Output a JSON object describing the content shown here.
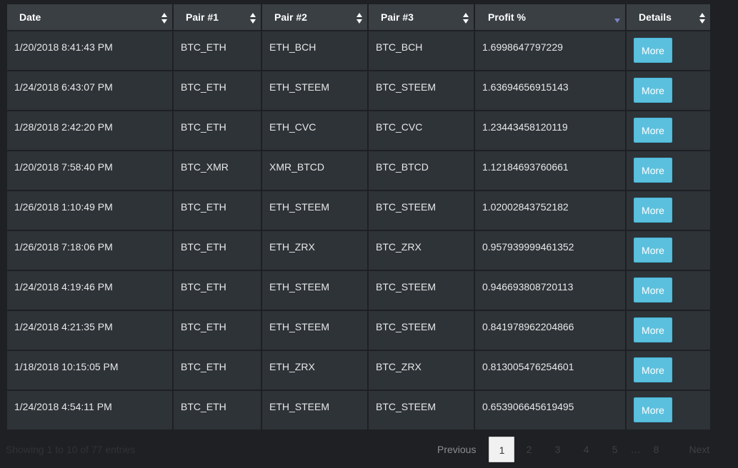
{
  "table": {
    "columns": [
      {
        "label": "Date",
        "sort": "both"
      },
      {
        "label": "Pair #1",
        "sort": "both"
      },
      {
        "label": "Pair #2",
        "sort": "both"
      },
      {
        "label": "Pair #3",
        "sort": "both"
      },
      {
        "label": "Profit %",
        "sort": "desc"
      },
      {
        "label": "Details",
        "sort": "both"
      }
    ],
    "button_label": "More",
    "rows": [
      {
        "date": "1/20/2018 8:41:43 PM",
        "pair1": "BTC_ETH",
        "pair2": "ETH_BCH",
        "pair3": "BTC_BCH",
        "profit": "1.6998647797229"
      },
      {
        "date": "1/24/2018 6:43:07 PM",
        "pair1": "BTC_ETH",
        "pair2": "ETH_STEEM",
        "pair3": "BTC_STEEM",
        "profit": "1.63694656915143"
      },
      {
        "date": "1/28/2018 2:42:20 PM",
        "pair1": "BTC_ETH",
        "pair2": "ETH_CVC",
        "pair3": "BTC_CVC",
        "profit": "1.23443458120119"
      },
      {
        "date": "1/20/2018 7:58:40 PM",
        "pair1": "BTC_XMR",
        "pair2": "XMR_BTCD",
        "pair3": "BTC_BTCD",
        "profit": "1.12184693760661"
      },
      {
        "date": "1/26/2018 1:10:49 PM",
        "pair1": "BTC_ETH",
        "pair2": "ETH_STEEM",
        "pair3": "BTC_STEEM",
        "profit": "1.02002843752182"
      },
      {
        "date": "1/26/2018 7:18:06 PM",
        "pair1": "BTC_ETH",
        "pair2": "ETH_ZRX",
        "pair3": "BTC_ZRX",
        "profit": "0.957939999461352"
      },
      {
        "date": "1/24/2018 4:19:46 PM",
        "pair1": "BTC_ETH",
        "pair2": "ETH_STEEM",
        "pair3": "BTC_STEEM",
        "profit": "0.946693808720113"
      },
      {
        "date": "1/24/2018 4:21:35 PM",
        "pair1": "BTC_ETH",
        "pair2": "ETH_STEEM",
        "pair3": "BTC_STEEM",
        "profit": "0.841978962204866"
      },
      {
        "date": "1/18/2018 10:15:05 PM",
        "pair1": "BTC_ETH",
        "pair2": "ETH_ZRX",
        "pair3": "BTC_ZRX",
        "profit": "0.813005476254601"
      },
      {
        "date": "1/24/2018 4:54:11 PM",
        "pair1": "BTC_ETH",
        "pair2": "ETH_STEEM",
        "pair3": "BTC_STEEM",
        "profit": "0.653906645619495"
      }
    ]
  },
  "info": "Showing 1 to 10 of 77 entries",
  "pagination": {
    "previous": "Previous",
    "pages": [
      "1",
      "2",
      "3",
      "4",
      "5"
    ],
    "ellipsis": "…",
    "last_page": "8",
    "next": "Next",
    "current": "1"
  },
  "colors": {
    "background": "#1f2023",
    "header_bg": "#3a3f44",
    "row_bg": "#2e3338",
    "button": "#5bc0de",
    "sort_active": "#7b84c7"
  }
}
